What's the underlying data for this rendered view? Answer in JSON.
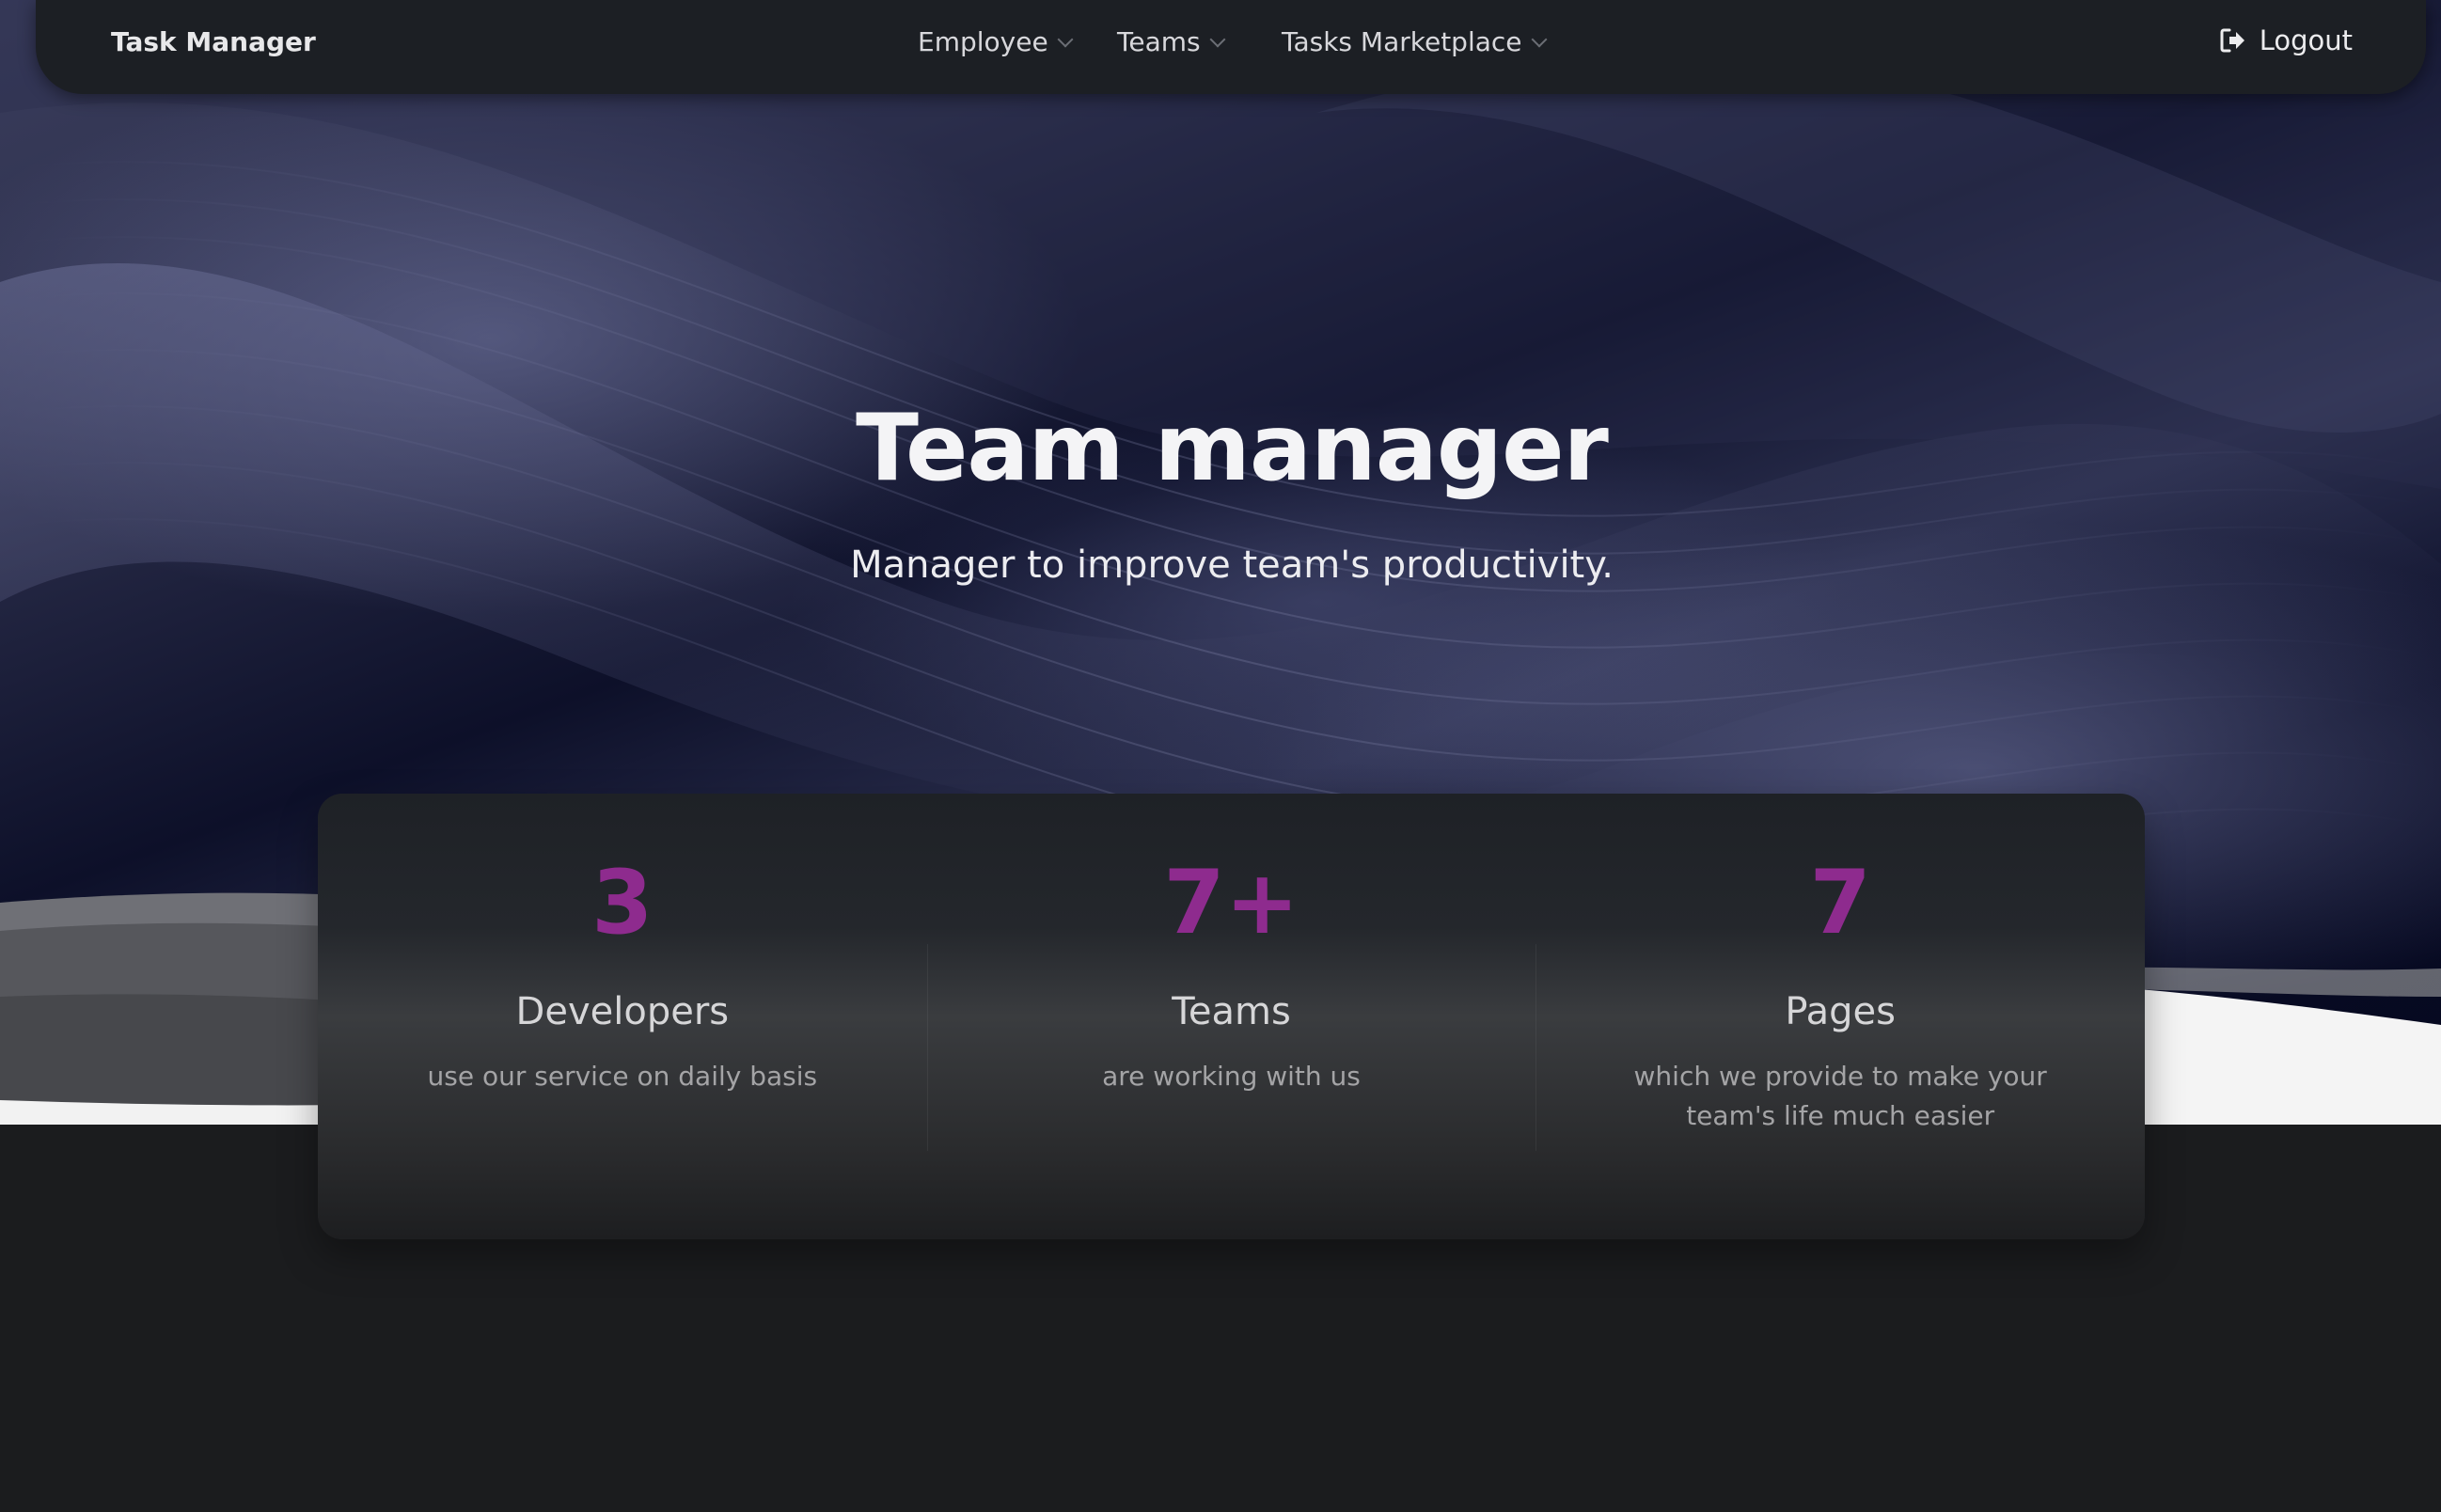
{
  "navbar": {
    "brand": "Task Manager",
    "items": [
      {
        "label": "Employee"
      },
      {
        "label": "Teams"
      },
      {
        "label": "Tasks Marketplace"
      }
    ],
    "logout_label": "Logout"
  },
  "hero": {
    "title": "Team manager",
    "subtitle": "Manager to improve team's productivity."
  },
  "stats": [
    {
      "value": "3",
      "label": "Developers",
      "description": "use our service on daily basis"
    },
    {
      "value": "7+",
      "label": "Teams",
      "description": "are working with us"
    },
    {
      "value": "7",
      "label": "Pages",
      "description": "which we provide to make your team's life much easier"
    }
  ],
  "colors": {
    "accent": "#8e2b8e",
    "navbar_bg": "#1c1f24",
    "page_bg": "#1b1c1e"
  }
}
